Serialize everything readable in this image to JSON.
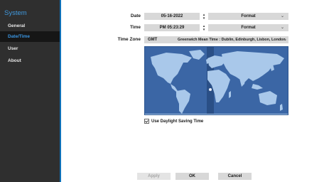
{
  "sidebar": {
    "title": "System",
    "items": [
      {
        "label": "General"
      },
      {
        "label": "Date/Time"
      },
      {
        "label": "User"
      },
      {
        "label": "About"
      }
    ]
  },
  "date": {
    "label": "Date",
    "value": "05-16-2022",
    "format": "Format"
  },
  "time": {
    "label": "Time",
    "value": "PM 05:23:29",
    "format": "Format"
  },
  "timezone": {
    "label": "Time Zone",
    "code": "GMT",
    "name": "Greenwich Mean Time : Dublin, Edinburgh, Lisbon, London"
  },
  "daylight": {
    "label": "Use Daylight Saving Time",
    "checked": true
  },
  "buttons": {
    "apply": "Apply",
    "ok": "OK",
    "cancel": "Cancel"
  },
  "colors": {
    "accent": "#3b96e3",
    "map_sea": "#3b66a5",
    "map_land": "#a9c8ea",
    "highlight": "#2a4f86"
  }
}
